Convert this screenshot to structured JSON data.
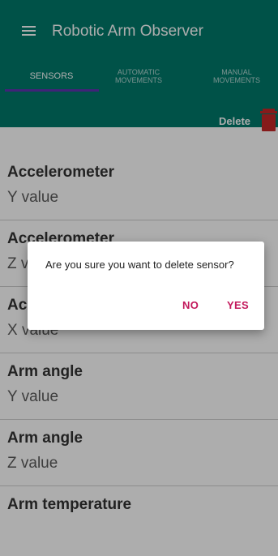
{
  "app": {
    "title": "Robotic Arm Observer"
  },
  "tabs": [
    {
      "label": "SENSORS"
    },
    {
      "label": "AUTOMATIC MOVEMENTS"
    },
    {
      "label": "MANUAL MOVEMENTS"
    }
  ],
  "toolbar": {
    "delete_label": "Delete"
  },
  "sensors": [
    {
      "name": "Accelerometer",
      "value": "Y value"
    },
    {
      "name": "Accelerometer",
      "value": "Z value"
    },
    {
      "name": "Accelerometer",
      "value": "X value"
    },
    {
      "name": "Arm angle",
      "value": "Y value"
    },
    {
      "name": "Arm angle",
      "value": "Z value"
    },
    {
      "name": "Arm temperature",
      "value": ""
    }
  ],
  "dialog": {
    "message": "Are you sure you want to delete sensor?",
    "no_label": "NO",
    "yes_label": "YES"
  },
  "colors": {
    "primary": "#00796b",
    "tab_indicator": "#5e35b1",
    "dialog_action": "#c2185b",
    "trash": "#c62828"
  },
  "icons": [
    "menu-icon",
    "trash-icon"
  ]
}
